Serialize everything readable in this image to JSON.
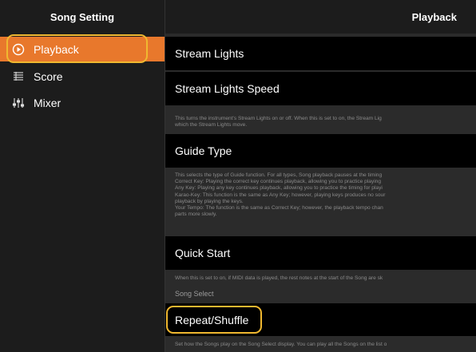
{
  "sidebar": {
    "title": "Song Setting",
    "items": [
      {
        "label": "Playback",
        "icon": "play-circle-icon"
      },
      {
        "label": "Score",
        "icon": "score-icon"
      },
      {
        "label": "Mixer",
        "icon": "mixer-icon"
      }
    ]
  },
  "main": {
    "title": "Playback",
    "rows": {
      "stream_lights": "Stream Lights",
      "stream_lights_speed": "Stream Lights Speed",
      "stream_desc": [
        "This turns the instrument's Stream Lights on or off. When this is set to on, the Stream Lig",
        "which the Stream Lights move."
      ],
      "guide_type": "Guide Type",
      "guide_desc": [
        "This selects the type of Guide function. For all types, Song playback pauses at the timing",
        "Correct Key: Playing the correct key continues playback, allowing you to practice playing",
        "Any Key: Playing any key continues playback, allowing you to practice the timing for playi",
        "Karao-Key: This function is the same as Any Key; however, playing keys produces no sour",
        "playback by playing the keys.",
        "Your Tempo: The function is the same as Correct Key; however, the playback tempo chan",
        "parts more slowly."
      ],
      "quick_start": "Quick Start",
      "quick_desc": "When this is set to on, if MIDI data is played, the rest notes at the start of the Song are sk",
      "song_select_label": "Song Select",
      "repeat_shuffle": "Repeat/Shuffle",
      "repeat_desc": "Set how the Songs play on the Song Select display. You can play all the Songs on the list o"
    }
  },
  "colors": {
    "accent": "#e8782c",
    "highlight": "#f0b830"
  }
}
